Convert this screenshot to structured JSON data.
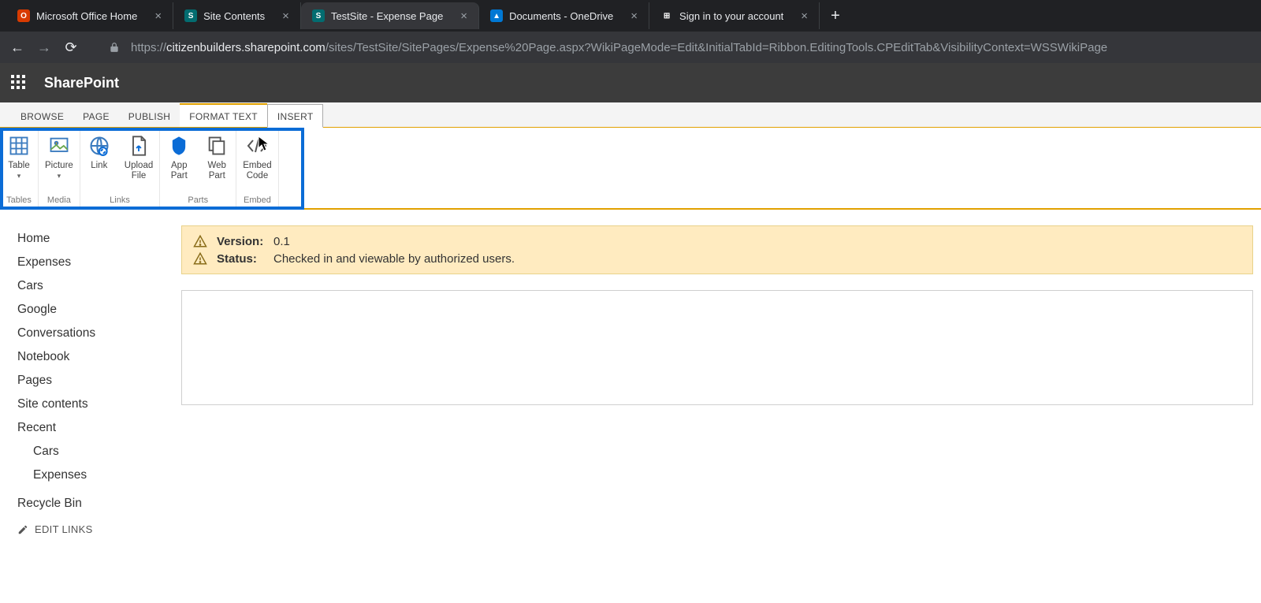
{
  "browser": {
    "tabs": [
      {
        "title": "Microsoft Office Home",
        "fav": {
          "bg": "#d83b01",
          "fg": "#fff",
          "glyph": "O"
        }
      },
      {
        "title": "Site Contents",
        "fav": {
          "bg": "#036c70",
          "fg": "#fff",
          "glyph": "S"
        }
      },
      {
        "title": "TestSite - Expense Page",
        "fav": {
          "bg": "#036c70",
          "fg": "#fff",
          "glyph": "S"
        },
        "active": true
      },
      {
        "title": "Documents - OneDrive",
        "fav": {
          "bg": "#0078d4",
          "fg": "#fff",
          "glyph": "▲"
        }
      },
      {
        "title": "Sign in to your account",
        "fav": {
          "bg": "transparent",
          "fg": "#fff",
          "glyph": "⊞"
        }
      }
    ],
    "url_prefix": "https://",
    "url_host": "citizenbuilders.sharepoint.com",
    "url_path": "/sites/TestSite/SitePages/Expense%20Page.aspx?WikiPageMode=Edit&InitialTabId=Ribbon.EditingTools.CPEditTab&VisibilityContext=WSSWikiPage"
  },
  "suite": {
    "title": "SharePoint"
  },
  "ribbon": {
    "tabs": [
      "BROWSE",
      "PAGE",
      "PUBLISH",
      "FORMAT TEXT",
      "INSERT"
    ],
    "active_tab": "INSERT",
    "groups": [
      {
        "label": "Tables",
        "items": [
          {
            "id": "table",
            "label": "Table",
            "caret": true
          }
        ]
      },
      {
        "label": "Media",
        "items": [
          {
            "id": "picture",
            "label": "Picture",
            "caret": true
          }
        ]
      },
      {
        "label": "Links",
        "items": [
          {
            "id": "link",
            "label": "Link"
          },
          {
            "id": "upload-file",
            "label": "Upload\nFile"
          }
        ]
      },
      {
        "label": "Parts",
        "items": [
          {
            "id": "app-part",
            "label": "App\nPart"
          },
          {
            "id": "web-part",
            "label": "Web\nPart"
          }
        ]
      },
      {
        "label": "Embed",
        "items": [
          {
            "id": "embed-code",
            "label": "Embed\nCode"
          }
        ]
      }
    ]
  },
  "leftnav": {
    "items": [
      "Home",
      "Expenses",
      "Cars",
      "Google",
      "Conversations",
      "Notebook",
      "Pages",
      "Site contents",
      "Recent"
    ],
    "recent": [
      "Cars",
      "Expenses"
    ],
    "recycle": "Recycle Bin",
    "edit_links": "EDIT LINKS"
  },
  "status": {
    "version_label": "Version:",
    "version_value": "0.1",
    "status_label": "Status:",
    "status_value": "Checked in and viewable by authorized users."
  }
}
